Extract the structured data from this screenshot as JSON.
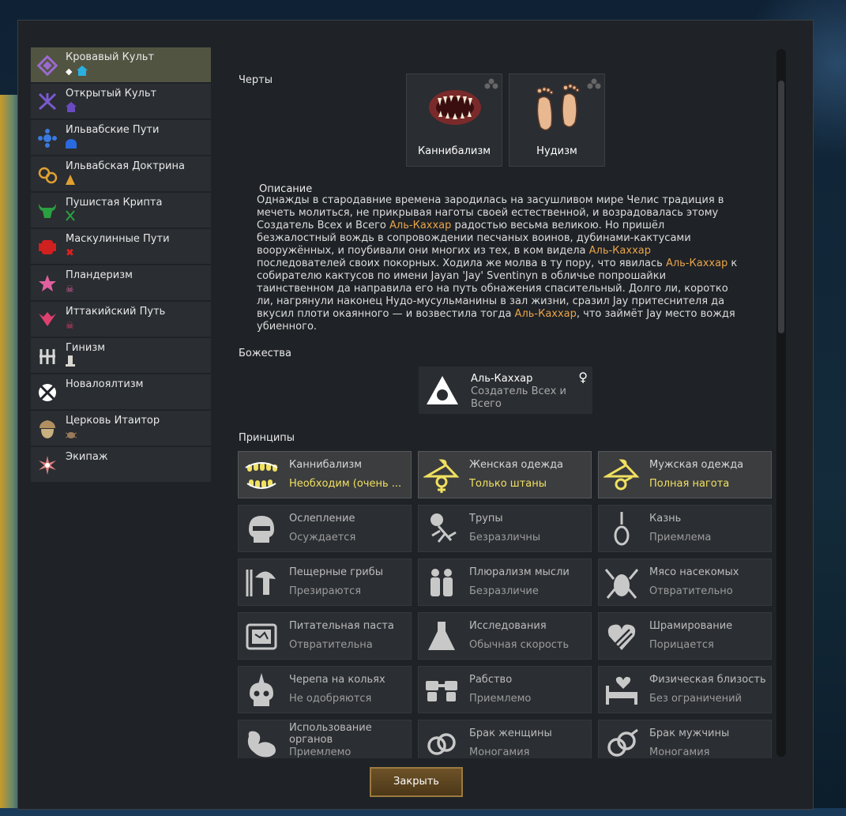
{
  "sidebar": {
    "items": [
      {
        "label": "Кровавый Культ",
        "icon": "diamond-eye-icon",
        "color": "#8a5ab0",
        "active": true
      },
      {
        "label": "Открытый Культ",
        "icon": "tentacles-icon",
        "color": "#7a5ad0"
      },
      {
        "label": "Ильвабские Пути",
        "icon": "cross-knot-icon",
        "color": "#3a7ae0"
      },
      {
        "label": "Ильвабская Доктрина",
        "icon": "rings-icon",
        "color": "#e0a030"
      },
      {
        "label": "Пушистая Крипта",
        "icon": "bull-head-icon",
        "color": "#2aa040"
      },
      {
        "label": "Маскулинные Пути",
        "icon": "fist-icon",
        "color": "#d02020"
      },
      {
        "label": "Пландеризм",
        "icon": "star-icon",
        "color": "#e060a0"
      },
      {
        "label": "Иттакийский Путь",
        "icon": "wings-icon",
        "color": "#e04070"
      },
      {
        "label": "Гинизм",
        "icon": "fork-icon",
        "color": "#d8d8d8"
      },
      {
        "label": "Новалоялтизм",
        "icon": "orb-icon",
        "color": "#ffffff"
      },
      {
        "label": "Церковь Итаитор",
        "icon": "acorn-icon",
        "color": "#b09060"
      },
      {
        "label": "Экипаж",
        "icon": "spark-icon",
        "color": "#e08080"
      }
    ]
  },
  "traits": {
    "heading": "Черты",
    "items": [
      {
        "name": "Каннибализм",
        "icon": "teeth-icon"
      },
      {
        "name": "Нудизм",
        "icon": "feet-icon"
      }
    ]
  },
  "description": {
    "heading": "Описание",
    "parts": [
      {
        "t": "Однажды в стародавние времена зародилась на засушливом мире Челис традиция в мечеть молиться, не прикрывая наготы своей естественной, и возрадовалась этому Создатель Всех и Всего "
      },
      {
        "t": "Аль-Каххар",
        "hl": true
      },
      {
        "t": " радостью весьма великою. Но пришёл безжалостный вождь в сопровождении песчаных воинов, дубинами-кактусами вооружённых, и поубивали они многих из тех, в ком видела "
      },
      {
        "t": "Аль-Каххар",
        "hl": true
      },
      {
        "t": " последователей своих покорных. Ходила же молва в ту пору, что явилась "
      },
      {
        "t": "Аль-Каххар",
        "hl": true
      },
      {
        "t": " к собирателю кактусов по имени Jayan 'Jay' Sventinyn в обличье попрошайки таинственном да направила его на путь обнажения спасительный. Долго ли, коротко ли, нагрянули наконец Нудо-мусульманины в зал жизни, сразил Jay притеснителя да вкусил плоти окаянного — и возвестила тогда "
      },
      {
        "t": "Аль-Каххар",
        "hl": true
      },
      {
        "t": ", что займёт Jay место вождя убиенного."
      }
    ]
  },
  "deities": {
    "heading": "Божества",
    "items": [
      {
        "name": "Аль-Каххар",
        "title": "Создатель Всех и Всего",
        "gender": "♀",
        "icon": "eye-triangle-icon"
      }
    ]
  },
  "precepts": {
    "heading": "Принципы",
    "items": [
      {
        "name": "Каннибализм",
        "value": "Необходим (очень ...",
        "icon": "teeth-icon",
        "highlight": true
      },
      {
        "name": "Женская одежда",
        "value": "Только штаны",
        "icon": "female-hanger-icon",
        "highlight": true
      },
      {
        "name": "Мужская одежда",
        "value": "Полная нагота",
        "icon": "male-hanger-icon",
        "highlight": true
      },
      {
        "name": "Ослепление",
        "value": "Осуждается",
        "icon": "blind-skull-icon"
      },
      {
        "name": "Трупы",
        "value": "Безразличны",
        "icon": "skeleton-icon"
      },
      {
        "name": "Казнь",
        "value": "Приемлема",
        "icon": "noose-icon"
      },
      {
        "name": "Пещерные грибы",
        "value": "Презираются",
        "icon": "mushroom-icon"
      },
      {
        "name": "Плюрализм мысли",
        "value": "Безразличие",
        "icon": "people-icon"
      },
      {
        "name": "Мясо насекомых",
        "value": "Отвратительно",
        "icon": "insect-icon"
      },
      {
        "name": "Питательная паста",
        "value": "Отвратительна",
        "icon": "paste-icon"
      },
      {
        "name": "Исследования",
        "value": "Обычная скорость",
        "icon": "flask-icon"
      },
      {
        "name": "Шрамирование",
        "value": "Порицается",
        "icon": "scar-heart-icon"
      },
      {
        "name": "Черепа на кольях",
        "value": "Не одобряются",
        "icon": "spike-skull-icon"
      },
      {
        "name": "Рабство",
        "value": "Приемлемо",
        "icon": "shackles-icon"
      },
      {
        "name": "Физическая близость",
        "value": "Без ограничений",
        "icon": "bed-heart-icon"
      },
      {
        "name": "Использование органов",
        "value": "Приемлемо",
        "icon": "organ-icon",
        "two_line": true
      },
      {
        "name": "Брак женщины",
        "value": "Моногамия",
        "icon": "rings-female-icon"
      },
      {
        "name": "Брак мужчины",
        "value": "Моногамия",
        "icon": "rings-male-icon"
      }
    ]
  },
  "close_button": "Закрыть",
  "colors": {
    "highlight_text": "#e8a44a",
    "precept_value_highlight": "#f0e060",
    "active_item": "#525442"
  }
}
